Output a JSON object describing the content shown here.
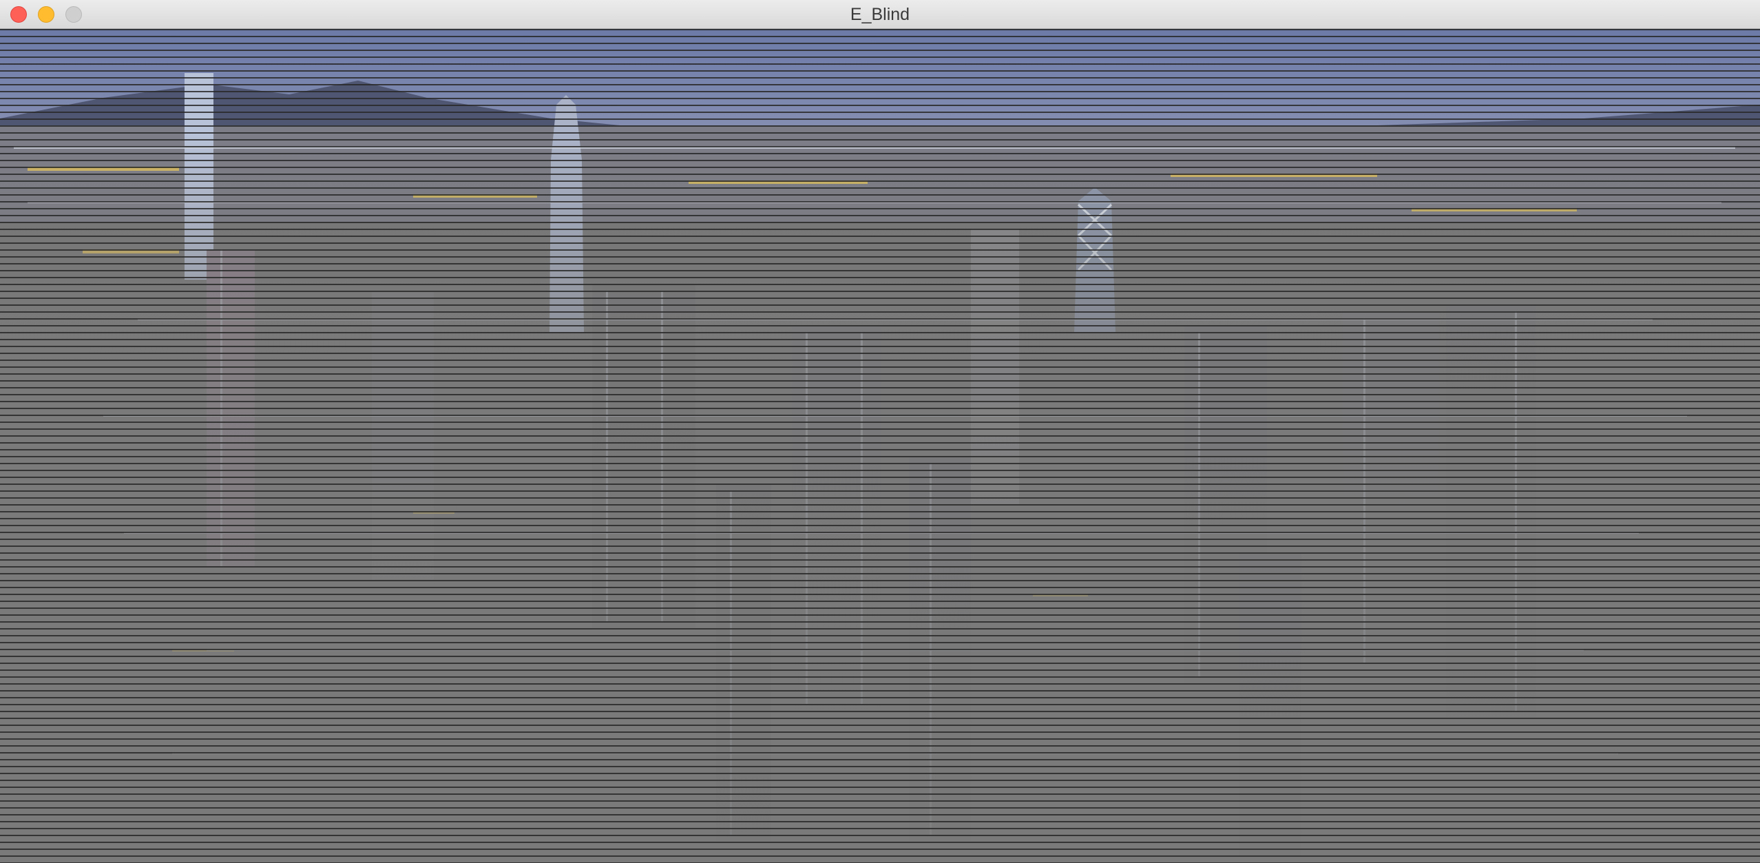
{
  "window": {
    "title": "E_Blind"
  },
  "canvas": {
    "scene": "city-skyline-night-icon",
    "effect": "horizontal-blinds"
  },
  "colors": {
    "overlay_gray": "#7a7a7a",
    "sky_top": "#5a6b9a",
    "sky_bottom": "#8a95b8",
    "city_light_yellow": "#e8c55a",
    "city_light_white": "#d8dde8",
    "blind_line": "#2a2a2a"
  }
}
